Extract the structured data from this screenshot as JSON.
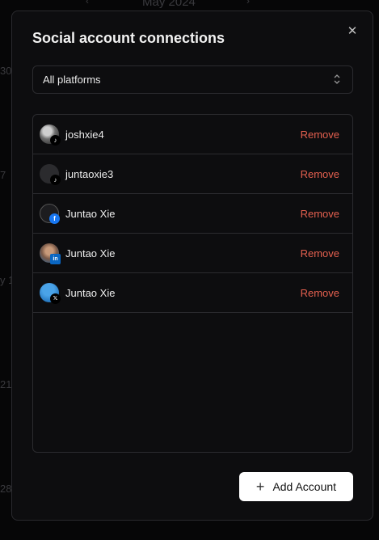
{
  "background": {
    "month": "May 2024",
    "row_numbers": [
      "30",
      "7",
      "y 1",
      "21",
      "28"
    ]
  },
  "modal": {
    "title": "Social account connections",
    "close_icon": "close-icon",
    "filter": {
      "selected": "All platforms"
    },
    "accounts": [
      {
        "name": "joshxie4",
        "platform": "tiktok",
        "action": "Remove"
      },
      {
        "name": "juntaoxie3",
        "platform": "tiktok",
        "action": "Remove"
      },
      {
        "name": "Juntao Xie",
        "platform": "facebook",
        "action": "Remove"
      },
      {
        "name": "Juntao Xie",
        "platform": "linkedin",
        "action": "Remove"
      },
      {
        "name": "Juntao Xie",
        "platform": "x",
        "action": "Remove"
      }
    ],
    "add_button": "Add Account"
  },
  "colors": {
    "remove": "#e5604f",
    "tiktok": "#000000",
    "facebook": "#1877f2",
    "linkedin": "#0a66c2",
    "x": "#000000"
  }
}
